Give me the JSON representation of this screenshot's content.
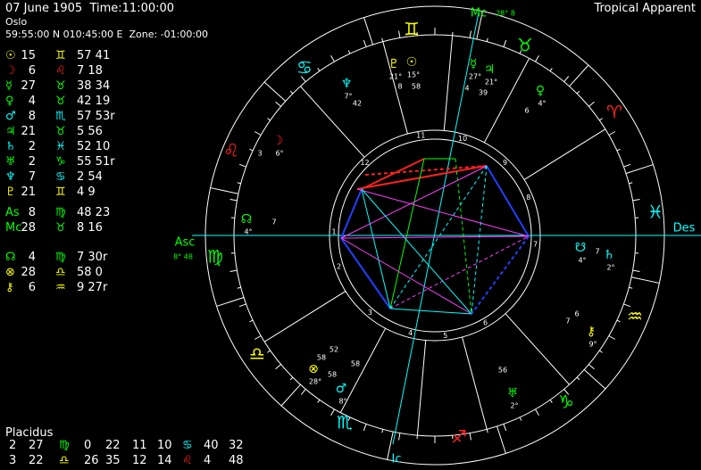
{
  "header": {
    "date": "07 June 1905",
    "time_label": "Time:11:00:00",
    "place": "Oslo",
    "coords": "59:55:00 N 010:45:00 E  Zone: -01:00:00",
    "mode": "Tropical Apparent"
  },
  "colors": {
    "yellow": "#ffff00",
    "red": "#ff2020",
    "green": "#00ff00",
    "cyan": "#00ffff",
    "magenta": "#ff40ff",
    "blue": "#2040ff",
    "white": "#ffffff"
  },
  "planets": [
    {
      "glyph": "☉",
      "color": "#ffff00",
      "deg": "15",
      "sign": "♊",
      "sign_color": "#ffff00",
      "min": "57 41"
    },
    {
      "glyph": "☽",
      "color": "#ff2020",
      "deg": "6",
      "sign": "♌",
      "sign_color": "#ff2020",
      "min": "7 18"
    },
    {
      "glyph": "☿",
      "color": "#00ff00",
      "deg": "27",
      "sign": "♉",
      "sign_color": "#00ff00",
      "min": "38 34"
    },
    {
      "glyph": "♀",
      "color": "#00ff00",
      "deg": "4",
      "sign": "♉",
      "sign_color": "#00ff00",
      "min": "42 19"
    },
    {
      "glyph": "♂",
      "color": "#00ffff",
      "deg": "8",
      "sign": "♏",
      "sign_color": "#00ffff",
      "min": "57 53r"
    },
    {
      "glyph": "♃",
      "color": "#00ff00",
      "deg": "21",
      "sign": "♉",
      "sign_color": "#00ff00",
      "min": "5 56"
    },
    {
      "glyph": "♄",
      "color": "#00ffff",
      "deg": "2",
      "sign": "♓",
      "sign_color": "#00ffff",
      "min": "52 10"
    },
    {
      "glyph": "♅",
      "color": "#00ff00",
      "deg": "2",
      "sign": "♑",
      "sign_color": "#00ff00",
      "min": "55 51r"
    },
    {
      "glyph": "♆",
      "color": "#00ffff",
      "deg": "7",
      "sign": "♋",
      "sign_color": "#00ffff",
      "min": "2 54"
    },
    {
      "glyph": "♇",
      "color": "#ffff00",
      "deg": "21",
      "sign": "♊",
      "sign_color": "#ffff00",
      "min": "4 9"
    }
  ],
  "angles": [
    {
      "glyph": "As",
      "color": "#00ff00",
      "deg": "8",
      "sign": "♍",
      "sign_color": "#00ff00",
      "min": "48 23"
    },
    {
      "glyph": "Mc",
      "color": "#00ff00",
      "deg": "28",
      "sign": "♉",
      "sign_color": "#00ff00",
      "min": "8 16"
    }
  ],
  "points": [
    {
      "glyph": "☊",
      "color": "#00ff00",
      "deg": "4",
      "sign": "♍",
      "sign_color": "#00ff00",
      "min": "7 30r"
    },
    {
      "glyph": "⊗",
      "color": "#ffff00",
      "deg": "28",
      "sign": "♎",
      "sign_color": "#ffff00",
      "min": "58 0"
    },
    {
      "glyph": "⚷",
      "color": "#ffff00",
      "deg": "6",
      "sign": "♒",
      "sign_color": "#ffff00",
      "min": "9 27r"
    }
  ],
  "houses": {
    "title": "Placidus",
    "rows": [
      {
        "h1": "2",
        "d1": "27",
        "s1": "♍",
        "s1c": "#00ff00",
        "m1": "0",
        "h2": "22",
        "d2": "11",
        "h3": "10",
        "s2": "♋",
        "s2c": "#00ffff",
        "d3": "40",
        "m3": "32"
      },
      {
        "h1": "3",
        "d1": "22",
        "s1": "♎",
        "s1c": "#ffff00",
        "m1": "26",
        "h2": "35",
        "d2": "12",
        "h3": "14",
        "s2": "♌",
        "s2c": "#ff2020",
        "d3": "4",
        "m3": "48"
      }
    ]
  },
  "wheel": {
    "axis_labels": {
      "asc": "Asc",
      "des": "Des",
      "mc": "Mc",
      "ic": "Ic"
    },
    "mc_degree": "28° 8",
    "asc_degree": "8° 48",
    "house_numbers": [
      "1",
      "2",
      "3",
      "4",
      "5",
      "6",
      "7",
      "8",
      "9",
      "10",
      "11",
      "12"
    ],
    "zodiac": [
      {
        "glyph": "♊",
        "color": "#ffff00"
      },
      {
        "glyph": "♉",
        "color": "#00ff00"
      },
      {
        "glyph": "♈",
        "color": "#ff2020"
      },
      {
        "glyph": "♓",
        "color": "#00ffff"
      },
      {
        "glyph": "♒",
        "color": "#ffff00"
      },
      {
        "glyph": "♑",
        "color": "#00ff00"
      },
      {
        "glyph": "♐",
        "color": "#ff2020"
      },
      {
        "glyph": "♏",
        "color": "#00ffff"
      },
      {
        "glyph": "♎",
        "color": "#ffff00"
      },
      {
        "glyph": "♍",
        "color": "#00ff00"
      },
      {
        "glyph": "♌",
        "color": "#ff2020"
      },
      {
        "glyph": "♋",
        "color": "#00ffff"
      }
    ],
    "planet_labels": [
      {
        "glyph": "♇",
        "color": "#ffff00",
        "label": "21°"
      },
      {
        "glyph": "☉",
        "color": "#ffff00",
        "label": "15°"
      },
      {
        "glyph": "☿",
        "color": "#00ff00",
        "label": "27°"
      },
      {
        "glyph": "♃",
        "color": "#00ff00",
        "label": "21°"
      },
      {
        "glyph": "♀",
        "color": "#00ff00",
        "label": "4°"
      },
      {
        "glyph": "♆",
        "color": "#00ffff",
        "label": "7°"
      },
      {
        "glyph": "☽",
        "color": "#ff2020",
        "label": "6°"
      },
      {
        "glyph": "☊",
        "color": "#00ff00",
        "label": "4°"
      },
      {
        "glyph": "♄",
        "color": "#00ffff",
        "label": "2°"
      },
      {
        "glyph": "☋",
        "color": "#00ffff",
        "label": "4°"
      },
      {
        "glyph": "⚷",
        "color": "#ffff00",
        "label": "9°"
      },
      {
        "glyph": "♅",
        "color": "#00ff00",
        "label": "2°"
      },
      {
        "glyph": "⊗",
        "color": "#ffff00",
        "label": "28°"
      },
      {
        "glyph": "♂",
        "color": "#00ffff",
        "label": "8°"
      }
    ],
    "small_labels": [
      "58",
      "4",
      "39",
      "6",
      "42",
      "3",
      "7",
      "7",
      "52",
      "58",
      "7",
      "56",
      "58",
      "58",
      "8",
      "6"
    ]
  }
}
